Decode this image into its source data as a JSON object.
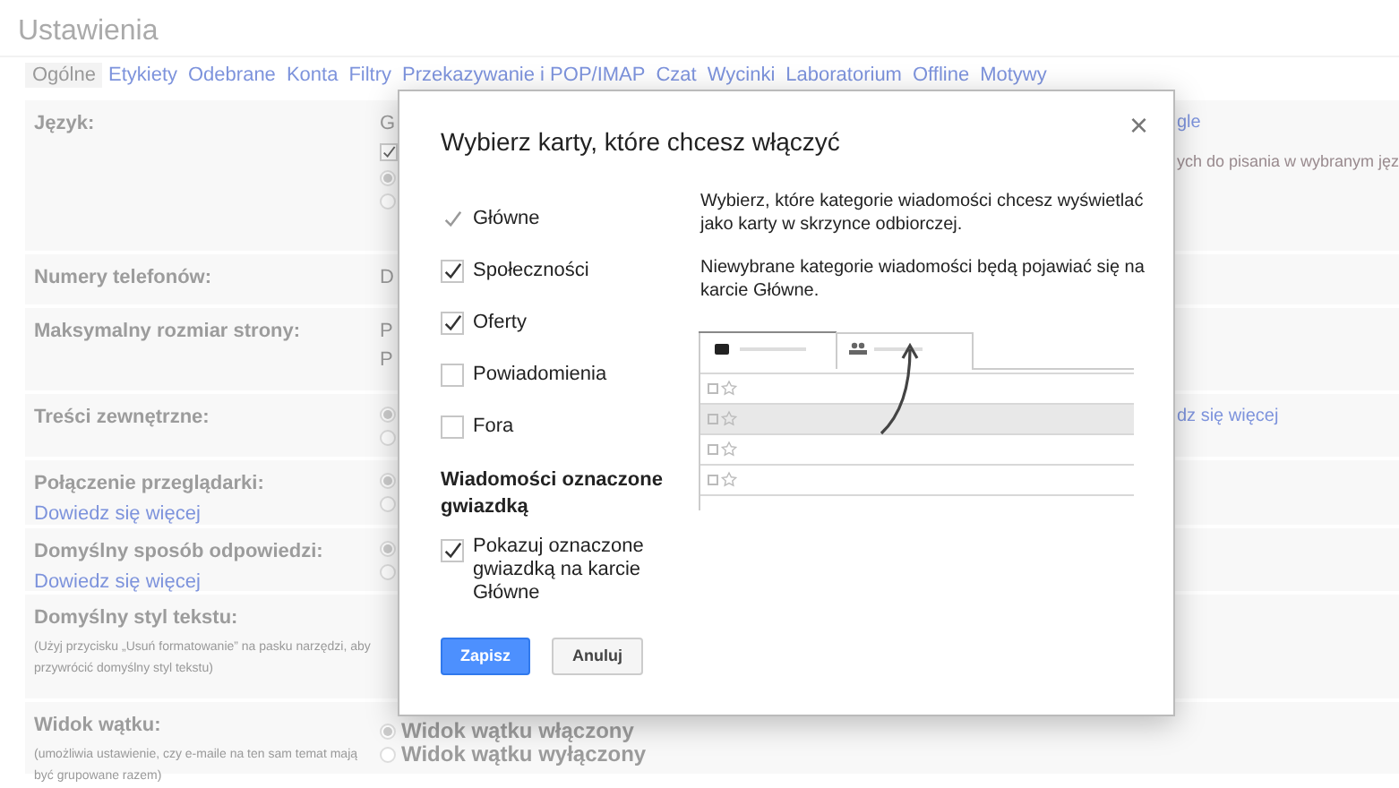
{
  "title": "Ustawienia",
  "tabs": [
    {
      "label": "Ogólne",
      "selected": true
    },
    {
      "label": "Etykiety",
      "selected": false
    },
    {
      "label": "Odebrane",
      "selected": false
    },
    {
      "label": "Konta",
      "selected": false
    },
    {
      "label": "Filtry",
      "selected": false
    },
    {
      "label": "Przekazywanie i POP/IMAP",
      "selected": false
    },
    {
      "label": "Czat",
      "selected": false
    },
    {
      "label": "Wycinki",
      "selected": false
    },
    {
      "label": "Laboratorium",
      "selected": false
    },
    {
      "label": "Offline",
      "selected": false
    },
    {
      "label": "Motywy",
      "selected": false
    }
  ],
  "settings": [
    {
      "label": "Język:",
      "left": [
        {
          "kind": "text",
          "text": "G"
        },
        {
          "kind": "checkbox",
          "checked": true
        },
        {
          "kind": "radio",
          "selected": true
        },
        {
          "kind": "radio",
          "selected": false
        }
      ],
      "right": [
        {
          "kind": "link",
          "text": "gle"
        },
        {
          "kind": "text",
          "text": "ych do pisania w wybranym jęz"
        }
      ]
    },
    {
      "label": "Numery telefonów:",
      "left": [
        {
          "kind": "text",
          "text": "D"
        }
      ]
    },
    {
      "label": "Maksymalny rozmiar strony:",
      "left": [
        {
          "kind": "text",
          "text": "P"
        },
        {
          "kind": "text",
          "text": "P"
        }
      ]
    },
    {
      "label": "Treści zewnętrzne:",
      "left": [
        {
          "kind": "radio",
          "selected": true
        },
        {
          "kind": "radio",
          "selected": false
        }
      ],
      "right": [
        {
          "kind": "link",
          "text": "dz się więcej"
        }
      ]
    },
    {
      "label": "Połączenie przeglądarki:",
      "link": "Dowiedz się więcej",
      "left": [
        {
          "kind": "radio",
          "selected": true
        },
        {
          "kind": "radio",
          "selected": false
        }
      ]
    },
    {
      "label": "Domyślny sposób odpowiedzi:",
      "link": "Dowiedz się więcej",
      "left": [
        {
          "kind": "radio",
          "selected": true
        },
        {
          "kind": "radio",
          "selected": false
        }
      ]
    },
    {
      "label": "Domyślny styl tekstu:",
      "note": "(Użyj przycisku „Usuń formatowanie” na pasku narzędzi, aby przywrócić domyślny styl tekstu)"
    },
    {
      "label": "Widok wątku:",
      "note": "(umożliwia ustawienie, czy e-maile na ten sam temat mają być grupowane razem)",
      "options": [
        {
          "label": "Widok wątku włączony",
          "selected": true
        },
        {
          "label": "Widok wątku wyłączony",
          "selected": false
        }
      ]
    }
  ],
  "dialog": {
    "title": "Wybierz karty, które chcesz włączyć",
    "close": "×",
    "categories": [
      {
        "label": "Główne",
        "checked": true,
        "disabled": true
      },
      {
        "label": "Społeczności",
        "checked": true,
        "disabled": false
      },
      {
        "label": "Oferty",
        "checked": true,
        "disabled": false
      },
      {
        "label": "Powiadomienia",
        "checked": false,
        "disabled": false
      },
      {
        "label": "Fora",
        "checked": false,
        "disabled": false
      }
    ],
    "starred_heading": "Wiadomości oznaczone gwiazdką",
    "starred_option": {
      "label": "Pokazuj oznaczone gwiazdką na karcie Główne",
      "checked": true
    },
    "description": [
      "Wybierz, które kategorie wiadomości chcesz wyświetlać jako karty w skrzynce odbiorczej.",
      "Niewybrane kategorie wiadomości będą pojawiać się na karcie Główne."
    ],
    "buttons": [
      {
        "label": "Zapisz",
        "kind": "primary"
      },
      {
        "label": "Anuluj",
        "kind": "secondary"
      }
    ]
  }
}
